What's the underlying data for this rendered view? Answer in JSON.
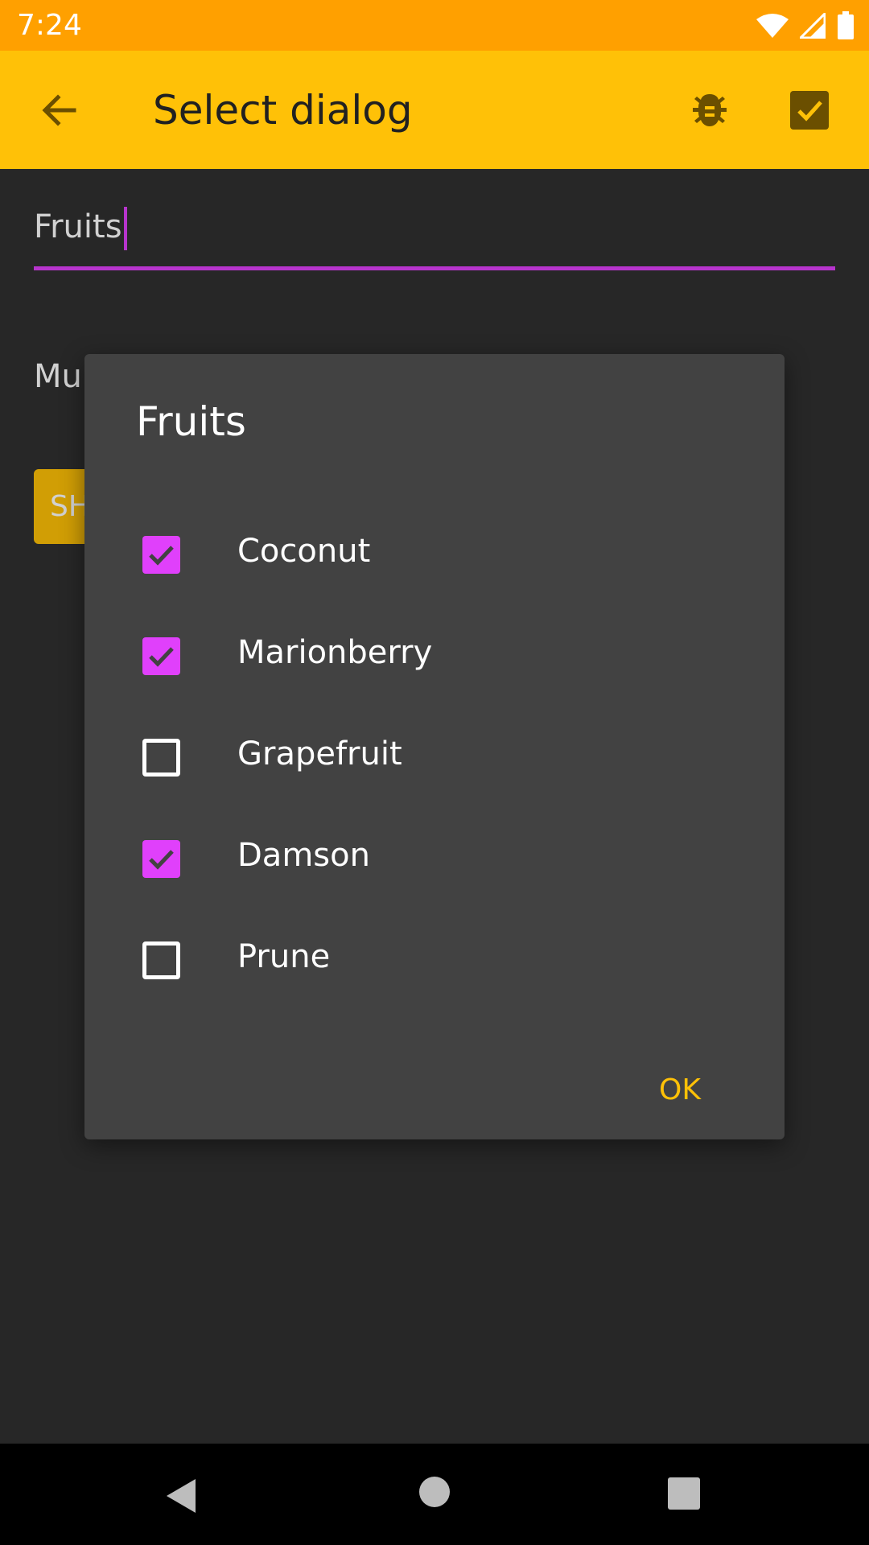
{
  "status_bar": {
    "time": "7:24",
    "icons": [
      "wifi-icon",
      "signal-icon",
      "battery-icon"
    ]
  },
  "app_bar": {
    "title": "Select dialog",
    "back_icon": "arrow-back-icon",
    "bug_icon": "bug-icon",
    "check_icon": "check-box-icon"
  },
  "background": {
    "input_value": "Fruits",
    "label_partial": "Mu",
    "button_partial": "SH"
  },
  "dialog": {
    "title": "Fruits",
    "options": [
      {
        "label": "Coconut",
        "checked": true
      },
      {
        "label": "Marionberry",
        "checked": true
      },
      {
        "label": "Grapefruit",
        "checked": false
      },
      {
        "label": "Damson",
        "checked": true
      },
      {
        "label": "Prune",
        "checked": false
      }
    ],
    "ok_label": "OK"
  },
  "colors": {
    "status_bar": "#FFA000",
    "app_bar": "#FFC107",
    "accent": "#E040FB",
    "dialog_bg": "#424242",
    "background": "#303030"
  }
}
